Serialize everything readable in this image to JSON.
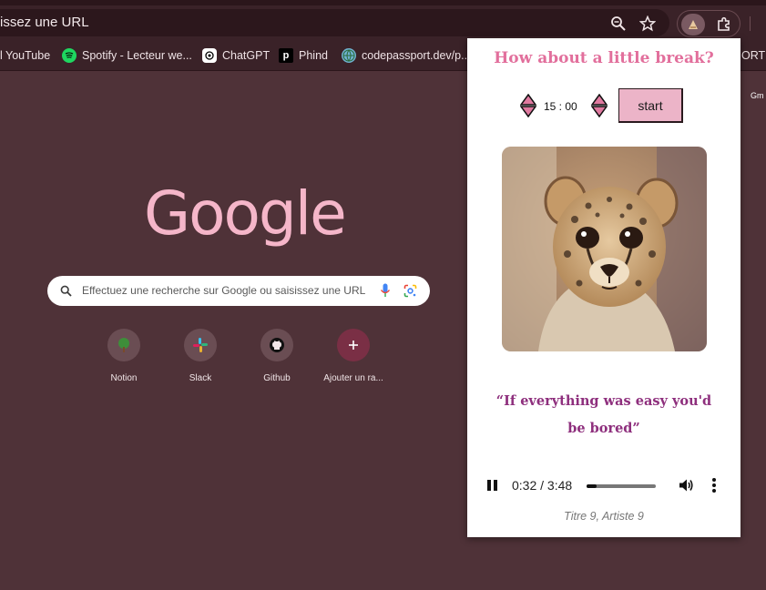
{
  "omnibox": {
    "text": "issez une URL"
  },
  "bookmarks": [
    {
      "label": "l YouTube",
      "icon": "youtube-icon"
    },
    {
      "label": "Spotify - Lecteur we...",
      "icon": "spotify-icon"
    },
    {
      "label": "ChatGPT",
      "icon": "chatgpt-icon"
    },
    {
      "label": "Phind",
      "icon": "phind-icon"
    },
    {
      "label": "codepassport.dev/p...",
      "icon": "globe-icon"
    },
    {
      "label": "ORT",
      "icon": ""
    }
  ],
  "google": {
    "logo": "Google",
    "search_placeholder": "Effectuez une recherche sur Google ou saisissez une URL",
    "shortcuts": [
      {
        "label": "Notion",
        "icon": "tree-icon"
      },
      {
        "label": "Slack",
        "icon": "slack-icon"
      },
      {
        "label": "Github",
        "icon": "github-icon"
      },
      {
        "label": "Ajouter un ra...",
        "icon": "plus-icon"
      }
    ],
    "gm": "Gm"
  },
  "popup": {
    "title": "How about a little break?",
    "time": "15 : 00",
    "start_label": "start",
    "quote": "“If everything was easy you'd be bored”",
    "player": {
      "current": "0:32",
      "duration": "3:48",
      "progress": 0.14
    },
    "track": "Titre 9, Artiste 9"
  },
  "colors": {
    "background": "#4f3238",
    "toolbar": "#3a2228",
    "accent_pink": "#e26f9c",
    "quote_purple": "#8e2f7d",
    "start_button": "#ecb4c8"
  }
}
